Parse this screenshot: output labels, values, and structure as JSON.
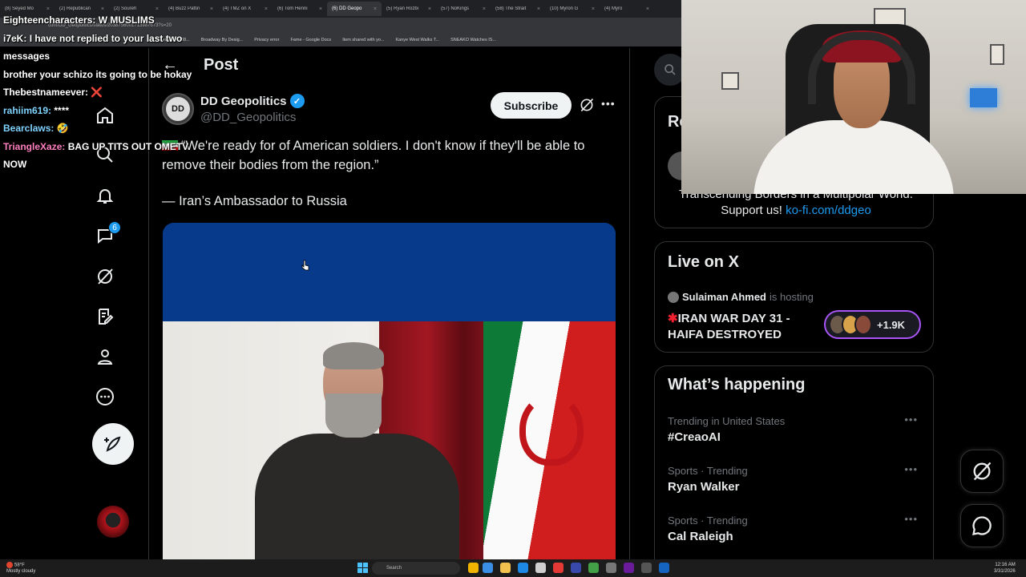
{
  "browser": {
    "tabs": [
      {
        "label": "(8) Seyed Mo"
      },
      {
        "label": "(2) Republican"
      },
      {
        "label": "(2) Soureh"
      },
      {
        "label": "(4) Buzz Pattin"
      },
      {
        "label": "(4) TMZ on X"
      },
      {
        "label": "(6) Tom Henni"
      },
      {
        "label": "(6) DD Geopo",
        "active": true
      },
      {
        "label": "(5) Ryan Rozbi"
      },
      {
        "label": "(57) NoKings"
      },
      {
        "label": "(58) The Strait"
      },
      {
        "label": "(10) Myron G"
      },
      {
        "label": "(4) Myro"
      }
    ],
    "url": "com/DD_Geopolitics/status/2038756001713987673?s=20",
    "bookmarks": [
      "Jesus Pro 38...",
      "Broadway By Desig...",
      "Privacy error",
      "Fame - Google Docs",
      "Item shared with yo...",
      "Kanye West Walks T...",
      "SNEAKO Watches IS..."
    ]
  },
  "chat": {
    "messages": [
      {
        "name": "Eighteencharacters:",
        "text": "W MUSLIMS",
        "color": "#ffffff"
      },
      {
        "name": "i7eK:",
        "text": "I have not replied to your last two messages",
        "color": "#ffffff"
      },
      {
        "name": "",
        "text": "brother your schizo its going to be hokay",
        "color": "#ffffff"
      },
      {
        "name": "Thebestnameever:",
        "text": "❌",
        "color": "#ffffff"
      },
      {
        "name": "rahiim619:",
        "text": "****",
        "color": "#7fd3ff"
      },
      {
        "name": "Bearclaws:",
        "text": "🤣",
        "color": "#7fd3ff"
      },
      {
        "name": "TriangleXaze:",
        "text": "BAG UP TITS OUT OMETV NOW",
        "color": "#ff7fbf"
      }
    ]
  },
  "nav": {
    "messages_badge": "6"
  },
  "post": {
    "header_title": "Post",
    "author_name": "DD Geopolitics",
    "author_handle": "@DD_Geopolitics",
    "avatar_text": "DD",
    "subscribe_label": "Subscribe",
    "text": "“We're ready for of American soldiers. I don't know if they'll be able to remove their bodies from the region.”",
    "quote": "— Iran’s Ambassador to Russia"
  },
  "sidebar": {
    "relevant_title": "Re",
    "relevant_bio": "Transcending Borders in a Multipolar World. Support us!",
    "relevant_link": "ko-fi.com/ddgeo",
    "live_title": "Live on X",
    "live_host": "Sulaiman Ahmed",
    "live_host_text": "is hosting",
    "live_stream_title": "IRAN WAR DAY 31 - HAIFA DESTROYED",
    "live_count": "+1.9K",
    "happening_title": "What’s happening",
    "trends": [
      {
        "meta": "Trending in United States",
        "name": "#CreaoAI"
      },
      {
        "meta": "Sports · Trending",
        "name": "Ryan Walker"
      },
      {
        "meta": "Sports · Trending",
        "name": "Cal Raleigh"
      }
    ]
  },
  "taskbar": {
    "weather_temp": "58°F",
    "weather_desc": "Mostly cloudy",
    "search_placeholder": "Search",
    "time": "12:16 AM",
    "date": "3/31/2026"
  },
  "colors": {
    "accent": "#1d9bf0",
    "live_ring": "#a855f7"
  }
}
